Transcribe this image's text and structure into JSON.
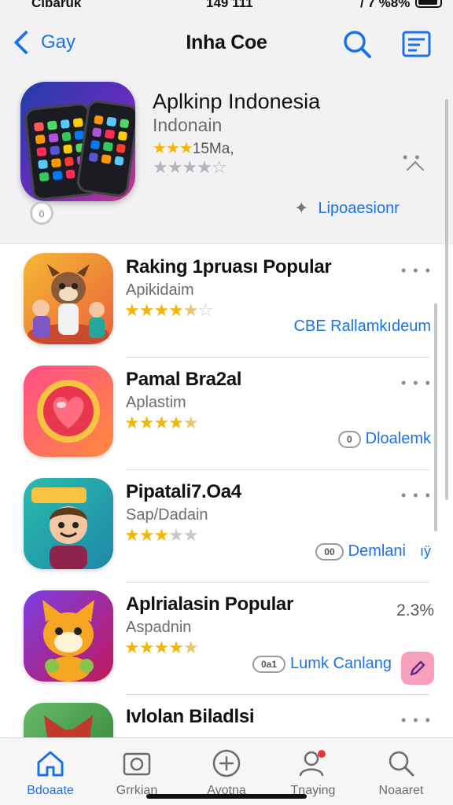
{
  "status_bar": {
    "carrier": "Cíbaruk",
    "time": "149 111",
    "signal": "/ 7 %8%"
  },
  "nav": {
    "back_label": "Gay",
    "title": "Inha Coe"
  },
  "featured": {
    "title": "Aplkinp Indonesia",
    "subtitle": "Indonain",
    "rating_text": "15Ma,",
    "rating_stars": 3,
    "rating_stars_2": 0,
    "action_label": "Lipoaesionr"
  },
  "apps": [
    {
      "name": "Raking 1pruası Popular",
      "subtitle": "Apikidaim",
      "stars": 4.5,
      "action_label": "CBE Rallamkıdeum",
      "right_text": ""
    },
    {
      "name": "Pamal Bra2al",
      "subtitle": "Aplastim",
      "stars": 4.5,
      "pill": "0",
      "action_label": "Dloalemk",
      "right_text": ""
    },
    {
      "name": "Pipatali7.Oa4",
      "subtitle": "Sap/Dadain",
      "stars": 3,
      "pill": "00",
      "action_label": "Demlani",
      "extra": "ıÿ",
      "right_text": ""
    },
    {
      "name": "Aplrialasin Popular",
      "subtitle": "Aspadnin",
      "stars": 4.5,
      "pill": "0a1",
      "action_label": "Lumk Canlang",
      "right_text": "2.3%"
    },
    {
      "name": "Ivlolan Biladlsi",
      "subtitle": "",
      "stars": 0,
      "action_label": "",
      "right_text": ""
    }
  ],
  "tabs": [
    {
      "label": "Bdoaate",
      "icon": "home-icon",
      "active": true
    },
    {
      "label": "Grrkian",
      "icon": "photo-icon",
      "active": false
    },
    {
      "label": "Avotna",
      "icon": "plus-circle-icon",
      "active": false
    },
    {
      "label": "Tnaying",
      "icon": "person-badge-icon",
      "active": false
    },
    {
      "label": "Noaaret",
      "icon": "search-icon",
      "active": false
    }
  ],
  "colors": {
    "accent": "#1a72e8",
    "star": "#f2b705",
    "background": "#f2f2f4"
  }
}
